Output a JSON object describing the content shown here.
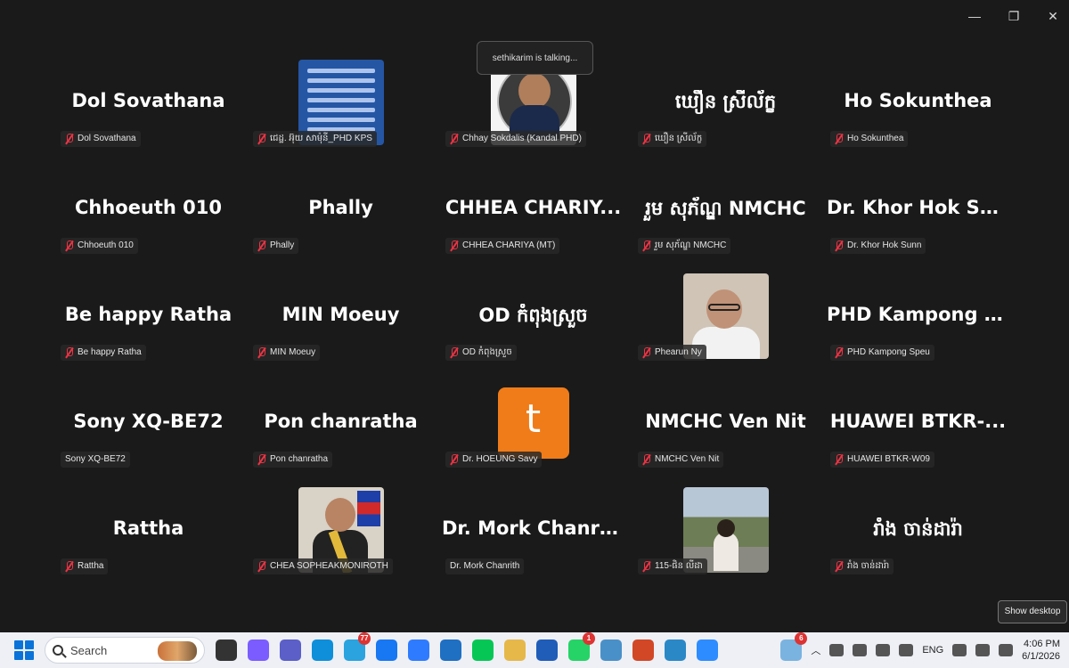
{
  "window": {
    "minimize_glyph": "—",
    "restore_glyph": "❐",
    "close_glyph": "✕"
  },
  "toast": {
    "text": "sethikarim is talking..."
  },
  "participants": [
    {
      "big": "Dol Sovathana",
      "label": "Dol Sovathana",
      "muted": true,
      "avatar": null
    },
    {
      "big": "",
      "label": "ជេដ្ឋ. អ៊ុយ សាម៉ុនី_PHD KPS",
      "muted": true,
      "avatar": "doc"
    },
    {
      "big": "",
      "label": "Chhay Sokdalis (Kandal PHD)",
      "muted": true,
      "avatar": "talk"
    },
    {
      "big": "ឃឿន ស្រីល័ក្ខ",
      "label": "ឃឿន ស្រីល័ក្ខ",
      "muted": true,
      "avatar": null
    },
    {
      "big": "Ho Sokunthea",
      "label": "Ho Sokunthea",
      "muted": true,
      "avatar": null
    },
    {
      "big": "Chhoeuth 010",
      "label": "Chhoeuth 010",
      "muted": true,
      "avatar": null
    },
    {
      "big": "Phally",
      "label": "Phally",
      "muted": true,
      "avatar": null
    },
    {
      "big": "CHHEA CHARIY...",
      "label": "CHHEA CHARIYA (MT)",
      "muted": true,
      "avatar": null
    },
    {
      "big": "រួម សុភ័ណ្ឌ NMCHC",
      "label": "រួម សុភ័ណ្ឌ NMCHC",
      "muted": true,
      "avatar": null
    },
    {
      "big": "Dr. Khor Hok Sunn",
      "label": "Dr. Khor Hok Sunn",
      "muted": true,
      "avatar": null
    },
    {
      "big": "Be happy Ratha",
      "label": "Be happy Ratha",
      "muted": true,
      "avatar": null
    },
    {
      "big": "MIN Moeuy",
      "label": "MIN Moeuy",
      "muted": true,
      "avatar": null
    },
    {
      "big": "OD កំពុងស្រួច",
      "label": "OD កំពុងស្រួច",
      "muted": true,
      "avatar": null
    },
    {
      "big": "",
      "label": "Phearun Ny",
      "muted": true,
      "avatar": "man"
    },
    {
      "big": "PHD Kampong S...",
      "label": "PHD Kampong Speu",
      "muted": true,
      "avatar": null
    },
    {
      "big": "Sony XQ-BE72",
      "label": "Sony XQ-BE72",
      "muted": false,
      "avatar": null
    },
    {
      "big": "Pon chanratha",
      "label": "Pon chanratha",
      "muted": true,
      "avatar": null
    },
    {
      "big": "",
      "label": "Dr. HOEUNG Savy",
      "muted": true,
      "avatar": "t"
    },
    {
      "big": "NMCHC Ven Nit",
      "label": "NMCHC Ven Nit",
      "muted": true,
      "avatar": null
    },
    {
      "big": "HUAWEI BTKR-...",
      "label": "HUAWEI BTKR-W09",
      "muted": true,
      "avatar": null
    },
    {
      "big": "Rattha",
      "label": "Rattha",
      "muted": true,
      "avatar": null
    },
    {
      "big": "",
      "label": "CHEA SOPHEAKMONIROTH",
      "muted": true,
      "avatar": "suit"
    },
    {
      "big": "Dr. Mork Chanrith",
      "label": "Dr. Mork Chanrith",
      "muted": false,
      "avatar": null
    },
    {
      "big": "",
      "label": "115-ផិន លីដា",
      "muted": true,
      "avatar": "wall"
    },
    {
      "big": "រាំង ចាន់ដារ៉ា",
      "label": "រាំង ចាន់ដារ៉ា",
      "muted": true,
      "avatar": null
    }
  ],
  "avatar_letter_t": "t",
  "taskbar": {
    "search_placeholder": "Search",
    "apps": [
      {
        "name": "file-explorer-dark",
        "color": "#333",
        "badge": ""
      },
      {
        "name": "copilot",
        "color": "#7b5cff",
        "badge": ""
      },
      {
        "name": "teams",
        "color": "#5b5fc7",
        "badge": ""
      },
      {
        "name": "edge",
        "color": "#0f8fd9",
        "badge": ""
      },
      {
        "name": "telegram",
        "color": "#2aa3df",
        "badge": "77"
      },
      {
        "name": "facebook",
        "color": "#1877f2",
        "badge": ""
      },
      {
        "name": "messenger",
        "color": "#2f7bff",
        "badge": ""
      },
      {
        "name": "store",
        "color": "#1f6fc2",
        "badge": ""
      },
      {
        "name": "line",
        "color": "#06c755",
        "badge": ""
      },
      {
        "name": "folder",
        "color": "#e6b84a",
        "badge": ""
      },
      {
        "name": "word",
        "color": "#1f5db8",
        "badge": ""
      },
      {
        "name": "whatsapp",
        "color": "#25d366",
        "badge": "1"
      },
      {
        "name": "pen-tool",
        "color": "#4a90c8",
        "badge": ""
      },
      {
        "name": "powerpoint",
        "color": "#d24726",
        "badge": ""
      },
      {
        "name": "security",
        "color": "#2a88c7",
        "badge": ""
      },
      {
        "name": "zoom",
        "color": "#2d8cff",
        "badge": ""
      }
    ],
    "weather_badge": "6",
    "language": "ENG",
    "time": "4:06 PM",
    "date": "6/1/2026",
    "show_desktop": "Show desktop"
  }
}
